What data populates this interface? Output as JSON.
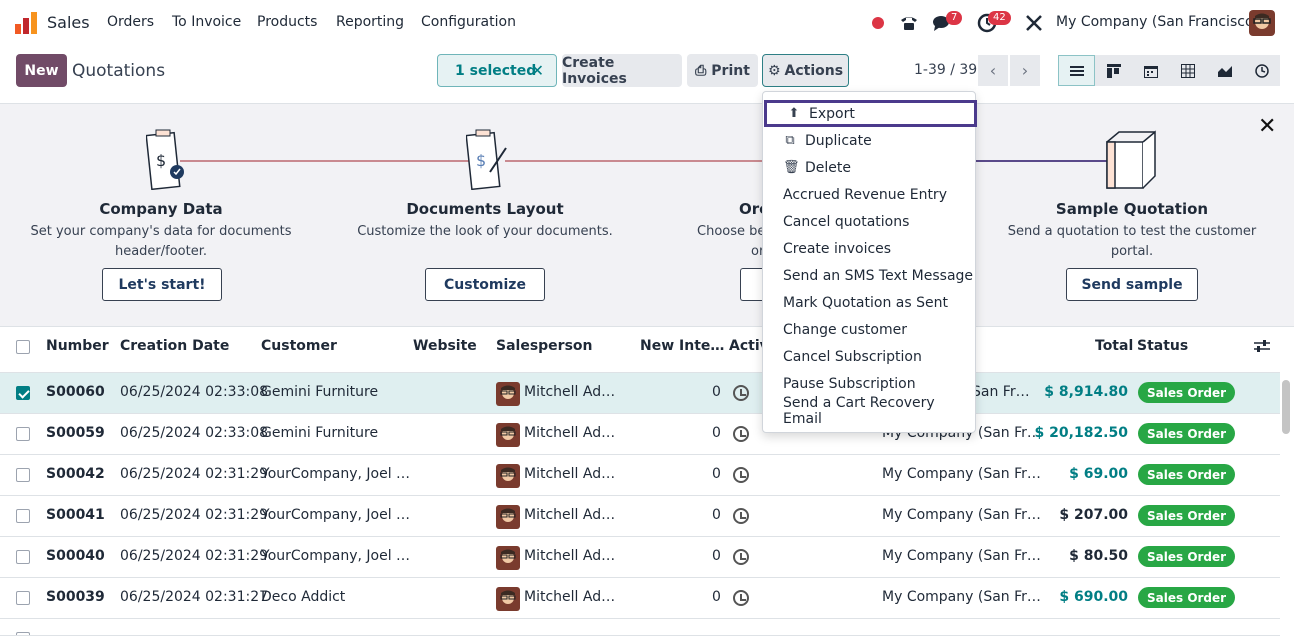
{
  "nav": {
    "app_name": "Sales",
    "menus": [
      "Orders",
      "To Invoice",
      "Products",
      "Reporting",
      "Configuration"
    ],
    "messages_count": "7",
    "activities_count": "42",
    "company": "My Company (San Francisco)"
  },
  "control": {
    "new_label": "New",
    "title": "Quotations",
    "selected_label": "1 selected",
    "create_invoices_label": "Create Invoices",
    "print_label": "Print",
    "actions_label": "Actions",
    "pager": "1-39 / 39"
  },
  "actions_menu": [
    {
      "label": "Export",
      "icon": "upload-icon"
    },
    {
      "label": "Duplicate",
      "icon": "copy-icon"
    },
    {
      "label": "Delete",
      "icon": "trash-icon"
    },
    {
      "label": "Accrued Revenue Entry"
    },
    {
      "label": "Cancel quotations"
    },
    {
      "label": "Create invoices"
    },
    {
      "label": "Send an SMS Text Message"
    },
    {
      "label": "Mark Quotation as Sent"
    },
    {
      "label": "Change customer"
    },
    {
      "label": "Cancel Subscription"
    },
    {
      "label": "Pause Subscription"
    },
    {
      "label": "Send a Cart Recovery Email"
    }
  ],
  "onboarding": {
    "steps": [
      {
        "title": "Company Data",
        "desc1": "Set your company's data for documents",
        "desc2": "header/footer.",
        "button": "Let's start!"
      },
      {
        "title": "Documents Layout",
        "desc1": "Customize the look of your documents.",
        "desc2": "",
        "button": "Customize"
      },
      {
        "title": "Orc",
        "desc1": "Choose bet",
        "desc2": "or",
        "button": ""
      },
      {
        "title": "Sample Quotation",
        "desc1": "Send a quotation to test the customer",
        "desc2": "portal.",
        "button": "Send sample"
      }
    ]
  },
  "table": {
    "headers": [
      "Number",
      "Creation Date",
      "Customer",
      "Website",
      "Salesperson",
      "New Inte…",
      "Activ",
      "Total",
      "Status"
    ],
    "rows": [
      {
        "number": "S00060",
        "date": "06/25/2024 02:33:08",
        "customer": "Gemini Furniture",
        "salesperson": "Mitchell Ad…",
        "interactions": "0",
        "company": "San Fr…",
        "total": "$ 8,914.80",
        "status": "Sales Order"
      },
      {
        "number": "S00059",
        "date": "06/25/2024 02:33:08",
        "customer": "Gemini Furniture",
        "salesperson": "Mitchell Ad…",
        "interactions": "0",
        "company": "My Company (San Fr…",
        "total": "$ 20,182.50",
        "status": "Sales Order"
      },
      {
        "number": "S00042",
        "date": "06/25/2024 02:31:29",
        "customer": "YourCompany, Joel …",
        "salesperson": "Mitchell Ad…",
        "interactions": "0",
        "company": "My Company (San Fr…",
        "total": "$ 69.00",
        "status": "Sales Order"
      },
      {
        "number": "S00041",
        "date": "06/25/2024 02:31:29",
        "customer": "YourCompany, Joel …",
        "salesperson": "Mitchell Ad…",
        "interactions": "0",
        "company": "My Company (San Fr…",
        "total": "$ 207.00",
        "status": "Sales Order"
      },
      {
        "number": "S00040",
        "date": "06/25/2024 02:31:29",
        "customer": "YourCompany, Joel …",
        "salesperson": "Mitchell Ad…",
        "interactions": "0",
        "company": "My Company (San Fr…",
        "total": "$ 80.50",
        "status": "Sales Order"
      },
      {
        "number": "S00039",
        "date": "06/25/2024 02:31:27",
        "customer": "Deco Addict",
        "salesperson": "Mitchell Ad…",
        "interactions": "0",
        "company": "My Company (San Fr…",
        "total": "$ 690.00",
        "status": "Sales Order"
      }
    ]
  },
  "colors": {
    "brand": "#714b67",
    "accent": "#017e84",
    "status_green": "#28a745"
  }
}
